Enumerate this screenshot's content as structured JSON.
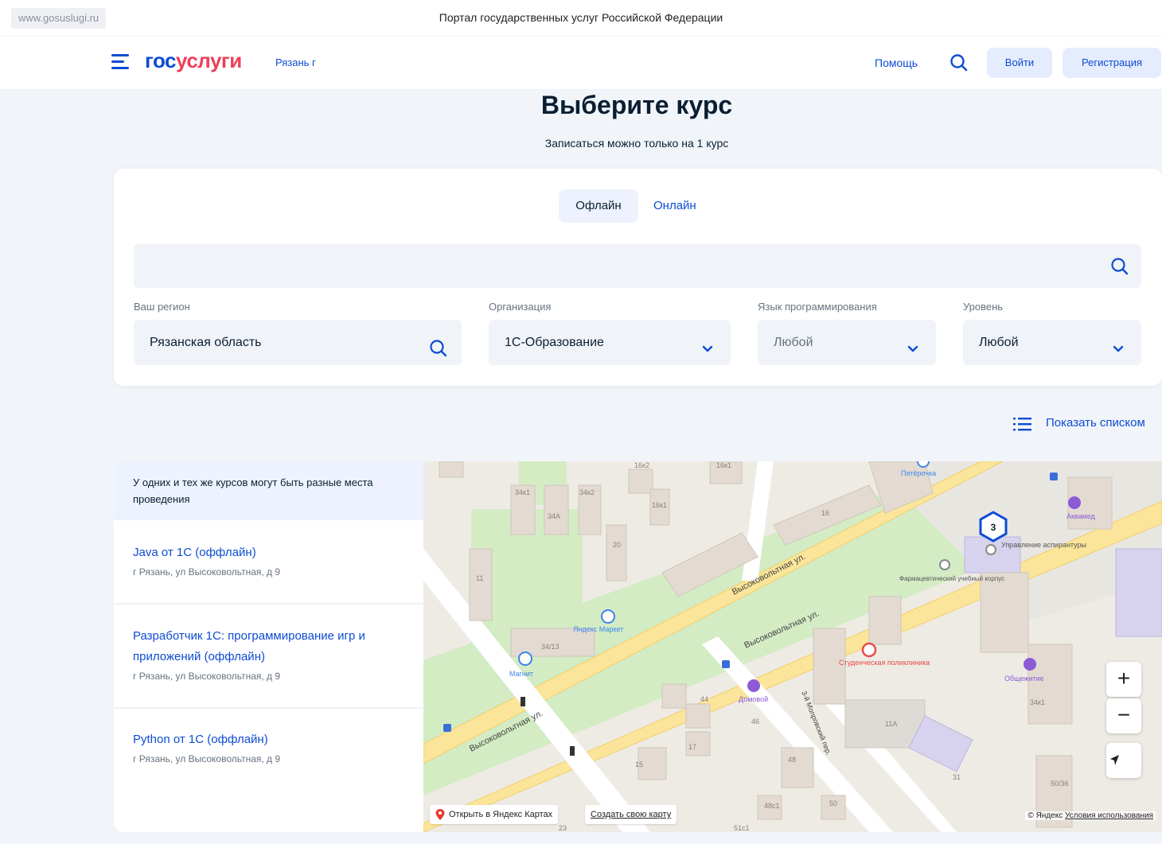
{
  "browser": {
    "url": "www.gosuslugi.ru",
    "title": "Портал государственных услуг Российской Федерации"
  },
  "header": {
    "logo_part1": "гос",
    "logo_part2": "услуги",
    "city": "Рязань г",
    "help": "Помощь",
    "login": "Войти",
    "register": "Регистрация"
  },
  "page": {
    "title": "Выберите курс",
    "subtitle": "Записаться можно только на 1 курс"
  },
  "tabs": [
    {
      "label": "Офлайн",
      "active": true
    },
    {
      "label": "Онлайн",
      "active": false
    }
  ],
  "search": {
    "placeholder": ""
  },
  "filters": {
    "region": {
      "label": "Ваш регион",
      "value": "Рязанская область"
    },
    "organization": {
      "label": "Организация",
      "value": "1С-Образование"
    },
    "language": {
      "label": "Язык программирования",
      "value": "Любой"
    },
    "level": {
      "label": "Уровень",
      "value": "Любой"
    }
  },
  "show_list": "Показать списком",
  "notice": "У одних и тех же курсов могут быть разные места проведения",
  "courses": [
    {
      "name": "Java от 1С (оффлайн)",
      "address": "г Рязань, ул Высоковольтная, д 9"
    },
    {
      "name": "Разработчик 1С: программирование игр и приложений (оффлайн)",
      "address": "г Рязань, ул Высоковольтная, д 9"
    },
    {
      "name": "Python от 1С (оффлайн)",
      "address": "г Рязань, ул Высоковольтная, д 9"
    }
  ],
  "map": {
    "cluster_count": "3",
    "street_label": "Высоковольтная ул.",
    "lane_label": "3-й Мопровский пер.",
    "pois": {
      "pyaterochka": "Пятёрочка",
      "akvamed": "Аквамед",
      "upravlenie": "Управление аспирантуры",
      "farm_korpus": "Фармацевтический учебный корпус",
      "yandex_market": "Яндекс Маркет",
      "magnit": "Магнит",
      "poliklinika": "Студенческая поликлиника",
      "obshchezhitie": "Общежитие",
      "domovoy": "Домовой"
    },
    "building_numbers": [
      "16к2",
      "16к1",
      "34к1",
      "34к2",
      "34А",
      "16к1",
      "20",
      "11",
      "34/13",
      "16",
      "44",
      "46",
      "17",
      "15",
      "48",
      "11А",
      "31",
      "50",
      "48с1",
      "51с1",
      "23",
      "50/36",
      "34к1"
    ],
    "zoom_in": "+",
    "zoom_out": "−",
    "open_in_yandex": "Открыть в Яндекс Картах",
    "create_map": "Создать свою карту",
    "copyright": "© Яндекс",
    "terms": "Условия использования"
  },
  "colors": {
    "brand_blue": "#0d4cd3",
    "brand_red": "#ee3f58",
    "page_bg": "#f1f5fa",
    "input_bg": "#f0f3f8"
  },
  "icons": {
    "menu": "burger-menu-icon",
    "search": "magnifier-icon",
    "chevron": "chevron-down-icon",
    "list": "list-icon",
    "geolocation": "arrow-navigation-icon",
    "map_pin": "map-pin-icon"
  }
}
